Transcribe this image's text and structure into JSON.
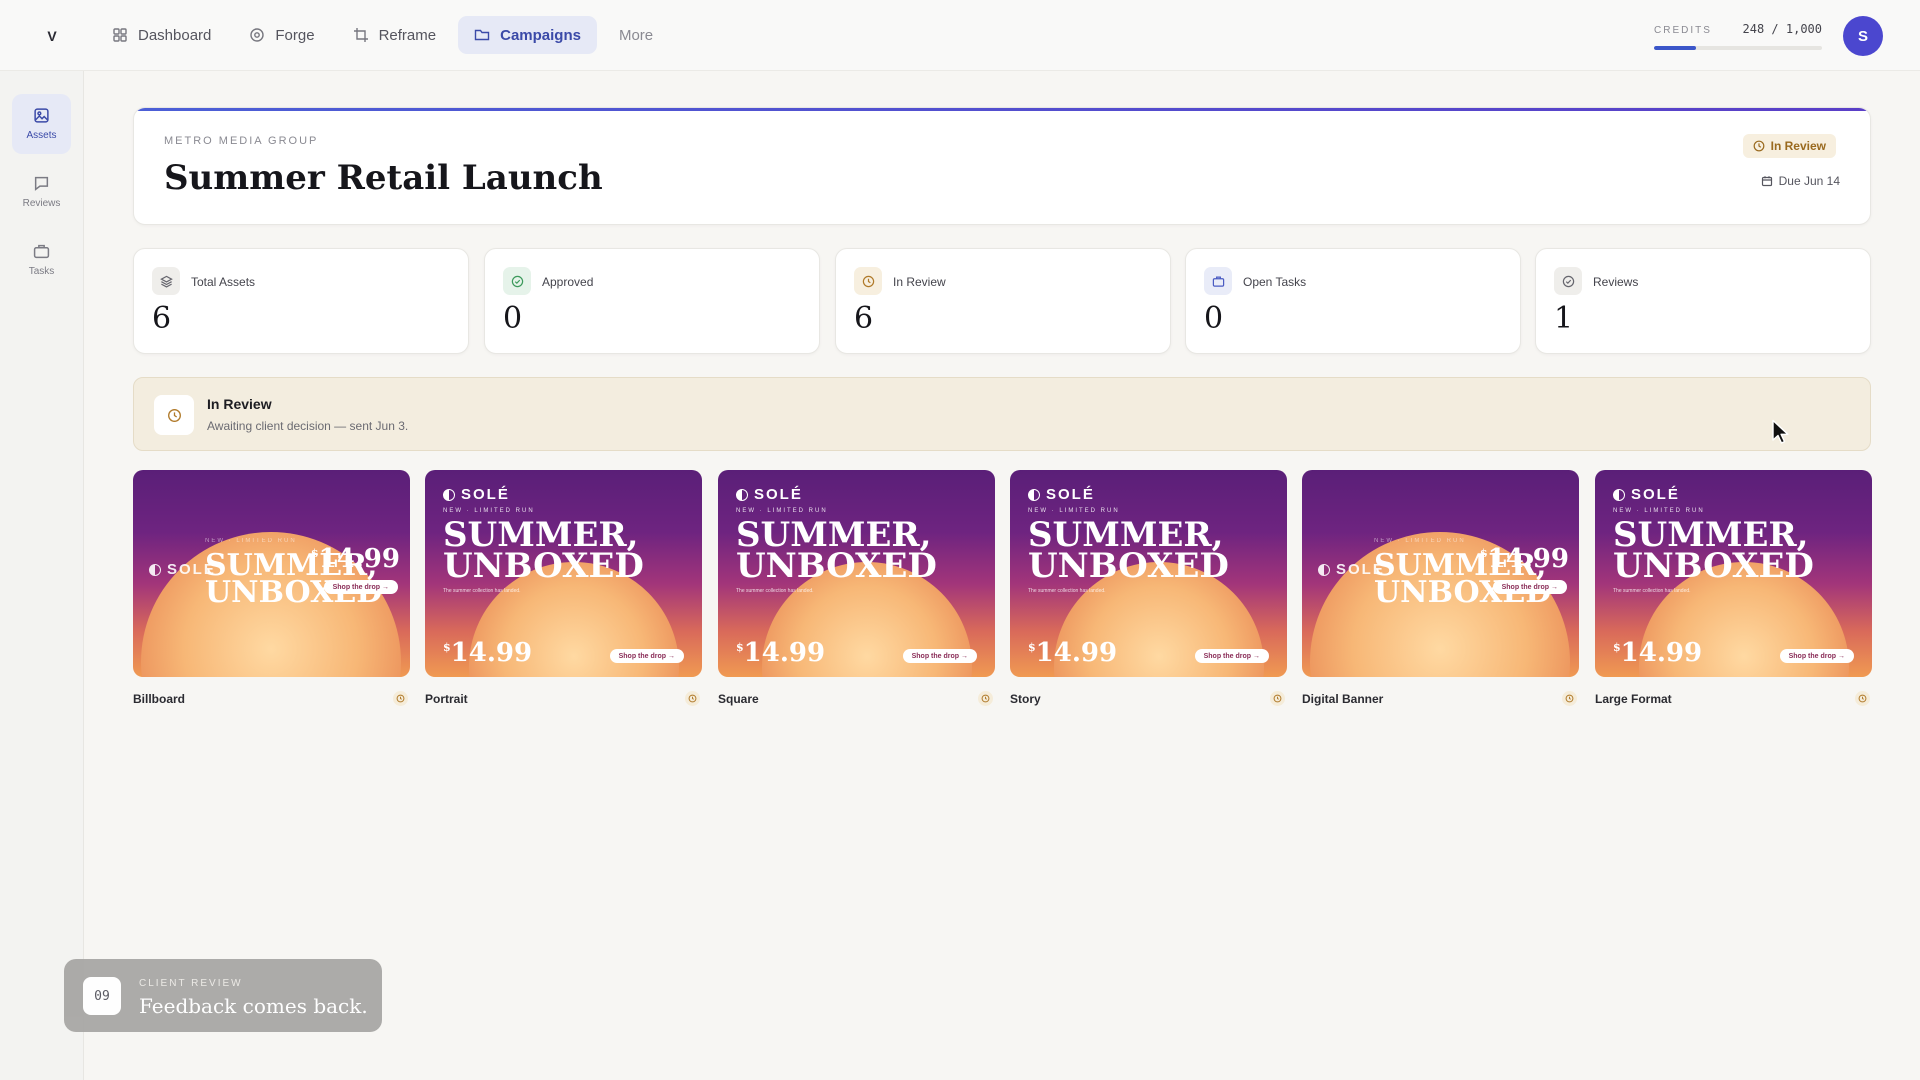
{
  "app": {
    "logo_letter": "V"
  },
  "nav": {
    "items": [
      {
        "label": "Dashboard",
        "icon": "grid-icon"
      },
      {
        "label": "Forge",
        "icon": "target-icon"
      },
      {
        "label": "Reframe",
        "icon": "crop-icon"
      },
      {
        "label": "Campaigns",
        "icon": "folder-icon",
        "active": true
      },
      {
        "label": "More"
      }
    ]
  },
  "credits": {
    "label": "CREDITS",
    "value": "248 / 1,000",
    "used_fraction": 0.248
  },
  "user": {
    "avatar_letter": "S"
  },
  "sidebar": {
    "items": [
      {
        "label": "Assets",
        "icon": "image-icon",
        "active": true
      },
      {
        "label": "Reviews",
        "icon": "chat-icon"
      },
      {
        "label": "Tasks",
        "icon": "briefcase-icon"
      }
    ]
  },
  "campaign": {
    "client": "METRO MEDIA GROUP",
    "title": "Summer Retail Launch",
    "status": "In Review",
    "due": "Due Jun 14"
  },
  "stats": [
    {
      "label": "Total Assets",
      "value": "6",
      "icon": "layers-icon",
      "icon_bg": "#efeeeb",
      "icon_color": "#66666e"
    },
    {
      "label": "Approved",
      "value": "0",
      "icon": "check-circle-icon",
      "icon_bg": "#e6f3ea",
      "icon_color": "#3d9a5c"
    },
    {
      "label": "In Review",
      "value": "6",
      "icon": "clock-icon",
      "icon_bg": "#f7efdf",
      "icon_color": "#b07a2a"
    },
    {
      "label": "Open Tasks",
      "value": "0",
      "icon": "briefcase-icon",
      "icon_bg": "#e9ecf8",
      "icon_color": "#4a5bc2"
    },
    {
      "label": "Reviews",
      "value": "1",
      "icon": "check-circle-icon",
      "icon_bg": "#efeeeb",
      "icon_color": "#66666e"
    }
  ],
  "banner": {
    "title": "In Review",
    "subtitle": "Awaiting client decision — sent Jun 3."
  },
  "creative": {
    "brand": "SOLÉ",
    "tagline": "NEW · LIMITED RUN",
    "headline_1": "SUMMER,",
    "headline_2": "UNBOXED",
    "blurb": "The summer collection has landed.",
    "price_currency": "$",
    "price": "14.99",
    "cta": "Shop the drop →"
  },
  "assets": [
    {
      "name": "Billboard",
      "layout": "wide"
    },
    {
      "name": "Portrait",
      "layout": "tall"
    },
    {
      "name": "Square",
      "layout": "tall"
    },
    {
      "name": "Story",
      "layout": "tall"
    },
    {
      "name": "Digital Banner",
      "layout": "wide"
    },
    {
      "name": "Large Format",
      "layout": "tall"
    }
  ],
  "toast": {
    "step": "09",
    "kicker": "CLIENT REVIEW",
    "message": "Feedback comes back."
  },
  "colors": {
    "accent": "#3b4aa8",
    "review_amber": "#b07a2a",
    "avatar": "#4b47cf"
  }
}
